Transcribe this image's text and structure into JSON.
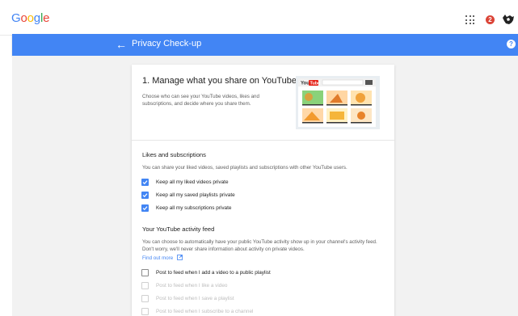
{
  "header": {
    "logo": "Google",
    "notification_count": "2"
  },
  "page": {
    "title": "Privacy Check-up",
    "help_symbol": "?"
  },
  "card": {
    "title": "1. Manage what you share on YouTube",
    "description": "Choose who can see your YouTube videos, likes and subscriptions, and decide where you share them.",
    "illustration": {
      "brand_you": "You",
      "brand_tube": "Tube"
    }
  },
  "likes": {
    "title": "Likes and subscriptions",
    "description": "You can share your liked videos, saved playlists and subscriptions with other YouTube users.",
    "options": [
      {
        "label": "Keep all my liked videos private",
        "checked": true
      },
      {
        "label": "Keep all my saved playlists private",
        "checked": true
      },
      {
        "label": "Keep all my subscriptions private",
        "checked": true
      }
    ]
  },
  "activity": {
    "title": "Your YouTube activity feed",
    "description": "You can choose to automatically have your public YouTube activity show up in your channel's activity feed. Don't worry, we'll never share information about activity on private videos.",
    "find_out_more": "Find out more",
    "options": [
      {
        "label": "Post to feed when I add a video to a public playlist",
        "checked": false,
        "disabled": false
      },
      {
        "label": "Post to feed when I like a video",
        "checked": false,
        "disabled": true
      },
      {
        "label": "Post to feed when I save a playlist",
        "checked": false,
        "disabled": true
      },
      {
        "label": "Post to feed when I subscribe to a channel",
        "checked": false,
        "disabled": true
      }
    ]
  },
  "colors": {
    "brand_blue": "#4285f4",
    "notification_red": "#db4437"
  }
}
